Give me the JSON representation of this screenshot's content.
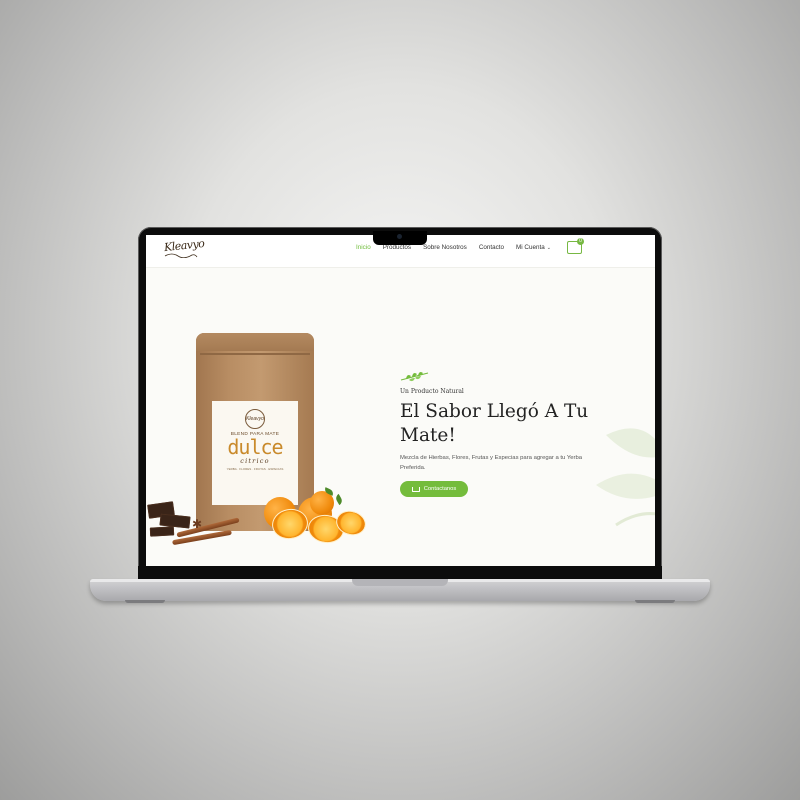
{
  "nav": {
    "logo": "Kleavyo",
    "items": [
      {
        "label": "Inicio",
        "active": true
      },
      {
        "label": "Productos",
        "active": false
      },
      {
        "label": "Sobre Nosotros",
        "active": false
      },
      {
        "label": "Contacto",
        "active": false
      },
      {
        "label": "Mi Cuenta",
        "active": false,
        "has_dropdown": true
      }
    ],
    "cart_count": "0",
    "accent_color": "#74bc3c"
  },
  "hero": {
    "kicker": "Un Producto Natural",
    "headline_line1": "El Sabor Llegó A Tu",
    "headline_line2": "Mate!",
    "description": "Mezcla de Hierbas, Flores, Frutas y Especias para agregar a tu Yerba Preferida.",
    "cta_label": "Contactanos"
  },
  "product": {
    "label_line": "BLEND PARA MATE",
    "label_name": "dulce",
    "label_script": "citrico",
    "label_note": "YERBA · FLORES · FRUTAS · ESPECIAS"
  }
}
